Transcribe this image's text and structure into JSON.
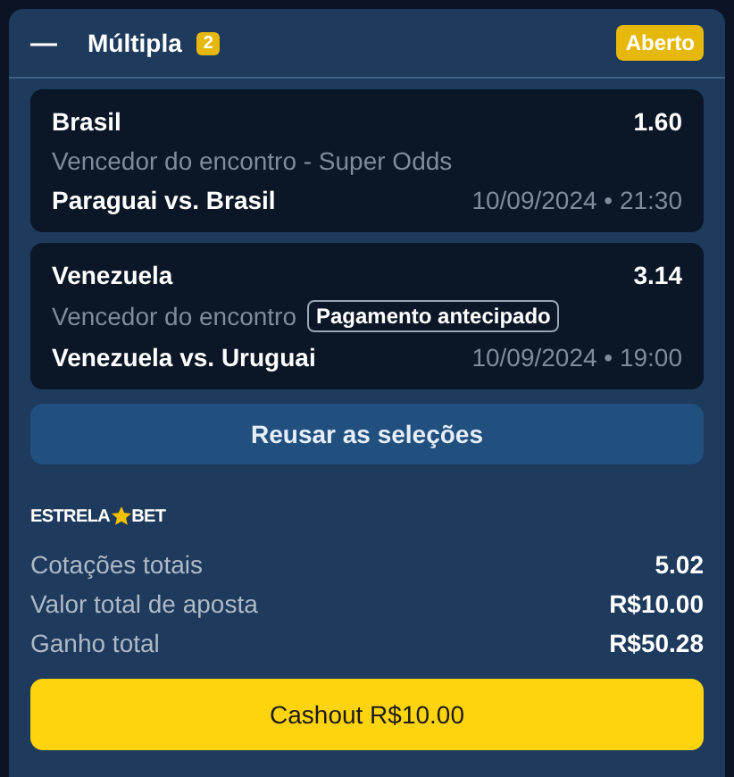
{
  "bet": {
    "collapse_icon": "—",
    "title": "Múltipla",
    "count": "2",
    "status": "Aberto"
  },
  "selections": [
    {
      "pick": "Brasil",
      "odds": "1.60",
      "market": "Vencedor do encontro - Super Odds",
      "match": "Paraguai vs. Brasil",
      "datetime": "10/09/2024 • 21:30"
    },
    {
      "pick": "Venezuela",
      "odds": "3.14",
      "market": "Vencedor do encontro",
      "tag": "Pagamento antecipado",
      "match": "Venezuela vs. Uruguai",
      "datetime": "10/09/2024 • 19:00"
    }
  ],
  "reuse_button": "Reusar as seleções",
  "logo": {
    "left": "ESTRELA",
    "right": "BET"
  },
  "summary": [
    {
      "label": "Cotações totais",
      "value": "5.02"
    },
    {
      "label": "Valor total de aposta",
      "value": "R$10.00"
    },
    {
      "label": "Ganho total",
      "value": "R$50.28"
    }
  ],
  "cashout_button": "Cashout R$10.00"
}
